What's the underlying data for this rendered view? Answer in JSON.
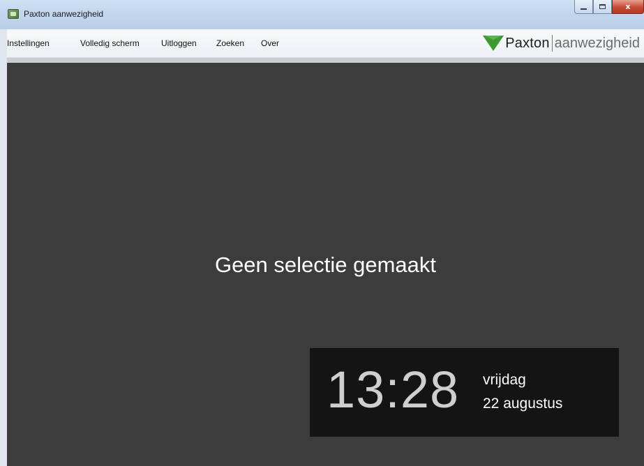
{
  "window": {
    "title": "Paxton aanwezigheid",
    "controls": {
      "minimize_icon": "minimize-icon",
      "maximize_icon": "maximize-icon",
      "close_label": "x"
    }
  },
  "menu": {
    "items": [
      {
        "label": "Instellingen"
      },
      {
        "label": "Volledig scherm"
      },
      {
        "label": "Uitloggen"
      },
      {
        "label": "Zoeken"
      },
      {
        "label": "Over"
      }
    ]
  },
  "logo": {
    "brand": "Paxton",
    "product": "aanwezigheid",
    "accent_color": "#3e9a2c"
  },
  "main": {
    "empty_message": "Geen selectie gemaakt",
    "background_color": "#3c3c3c"
  },
  "clock": {
    "time": "13:28",
    "weekday": "vrijdag",
    "date": "22 augustus"
  }
}
